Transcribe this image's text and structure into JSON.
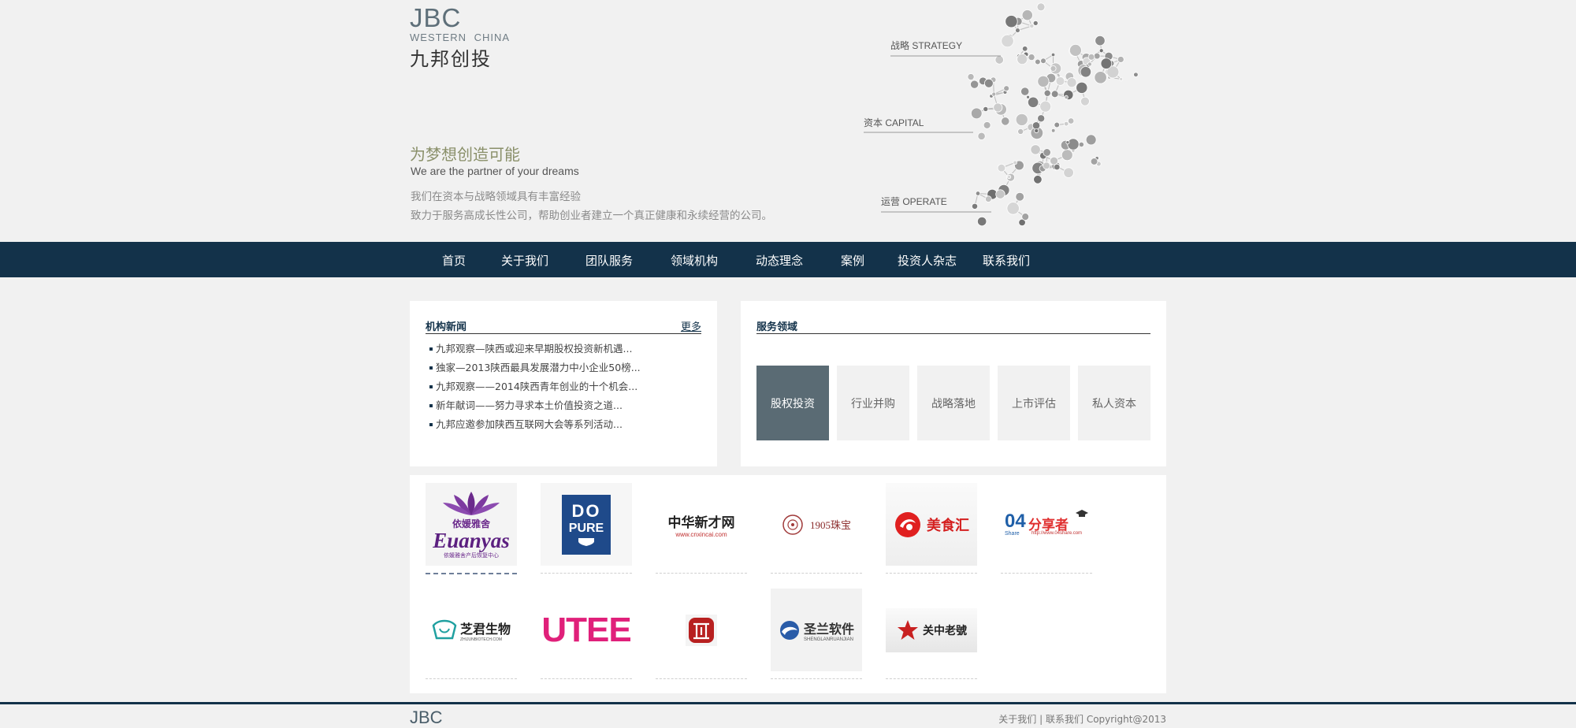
{
  "header": {
    "logo_main": "JBC",
    "logo_sub": "WESTERN CHINA",
    "logo_cn": "九邦创投",
    "slogan_cn": "为梦想创造可能",
    "slogan_en": "We are the partner of your dreams",
    "desc_line1": "我们在资本与战略领域具有丰富经验",
    "desc_line2": "致力于服务高成长性公司，帮助创业者建立一个真正健康和永续经营的公司。",
    "callouts": {
      "strategy": "战略 STRATEGY",
      "capital": "资本 CAPITAL",
      "operate": "运营 OPERATE"
    }
  },
  "nav": {
    "items": [
      "首页",
      "关于我们",
      "团队服务",
      "领域机构",
      "动态理念",
      "案例",
      "投资人杂志",
      "联系我们"
    ]
  },
  "news": {
    "title": "机构新闻",
    "more": "更多",
    "items": [
      "九邦观察—陕西或迎来早期股权投资新机遇...",
      "独家—2013陕西最具发展潜力中小企业50榜...",
      "九邦观察——2014陕西青年创业的十个机会...",
      "新年献词——努力寻求本土价值投资之道...",
      "九邦应邀参加陕西互联网大会等系列活动..."
    ]
  },
  "services": {
    "title": "服务领域",
    "items": [
      "股权投资",
      "行业并购",
      "战略落地",
      "上市评估",
      "私人资本"
    ],
    "active_index": 0
  },
  "partners": {
    "euanyas": {
      "cn": "依媛雅舍",
      "en": "Euanyas",
      "sub": "依媛雅舍产后恢复中心"
    },
    "dopure": {
      "text_top": "DO",
      "text_bottom": "PURE"
    },
    "zhonghua": {
      "cn": "中华新才网",
      "url": "www.cnxincai.com"
    },
    "y1905": {
      "text": "1905珠宝"
    },
    "meishihui": {
      "text": "美食汇"
    },
    "share": {
      "num": "04",
      "cn": "分享者",
      "en": "Share",
      "url": "http://www.04share.com"
    },
    "zhijun": {
      "cn": "芝君生物",
      "en": "ZHIJUNBIOTECH.COM"
    },
    "utee": {
      "text": "UTEE"
    },
    "shenglan": {
      "cn": "圣兰软件",
      "en": "SHENGLANRUANJIAN"
    },
    "guanzhong": {
      "text": "关中老號"
    }
  },
  "footer": {
    "logo": "JBC",
    "about": "关于我们",
    "sep": "|",
    "contact": "联系我们",
    "copyright": "Copyright@2013"
  },
  "colors": {
    "nav_bg": "#13324a",
    "active_tile": "#5a6b74",
    "page_bg": "#f1f1f1"
  }
}
